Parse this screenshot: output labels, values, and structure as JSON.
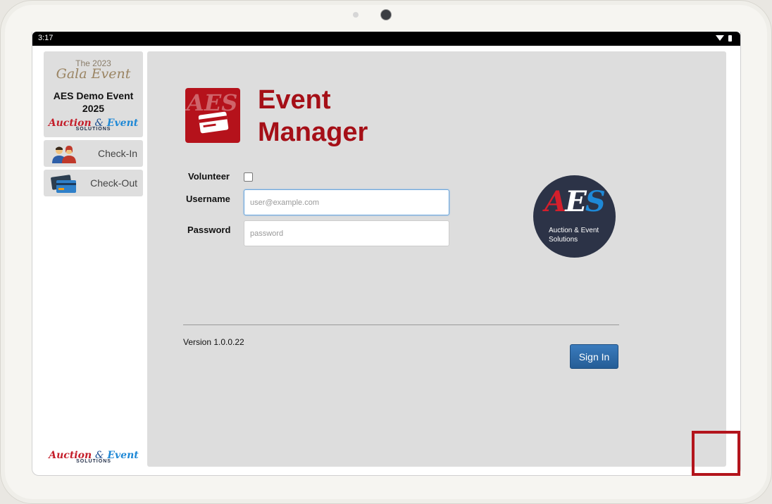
{
  "status_bar": {
    "time": "3:17"
  },
  "sidebar": {
    "event_card": {
      "gala_year": "The 2023",
      "gala_name": "Gala Event",
      "event_name": "AES Demo Event 2025",
      "brand": {
        "word1": "Auction",
        "amp": "&",
        "word2": "Event",
        "sub": "SOLUTIONS"
      }
    },
    "nav": [
      {
        "label": "Check-In",
        "icon": "people-icon"
      },
      {
        "label": "Check-Out",
        "icon": "credit-cards-icon"
      }
    ],
    "footer_brand": {
      "word1": "Auction",
      "amp": "&",
      "word2": "Event",
      "sub": "SOLUTIONS"
    }
  },
  "main": {
    "app_title_line1": "Event",
    "app_title_line2": "Manager",
    "app_icon": {
      "monogram": "AES"
    },
    "form": {
      "volunteer_label": "Volunteer",
      "volunteer_checked": false,
      "username_label": "Username",
      "username_placeholder": "user@example.com",
      "password_label": "Password",
      "password_placeholder": "password"
    },
    "logo": {
      "m1": "A",
      "m2": "E",
      "m3": "S",
      "line1": "Auction & Event",
      "line2": "Solutions"
    },
    "version": "Version 1.0.0.22",
    "signin_label": "Sign In"
  },
  "colors": {
    "brand_red": "#a50f17",
    "panel_gray": "#dddddd",
    "button_blue": "#2d6aa6",
    "logo_navy": "#2c3347",
    "highlight": "#b3141c"
  }
}
